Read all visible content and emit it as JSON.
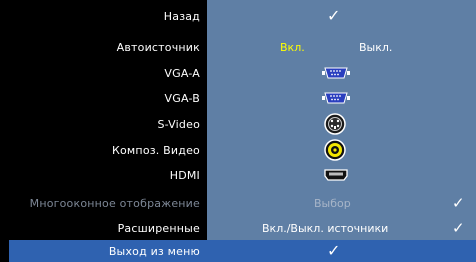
{
  "menu": {
    "rows": [
      {
        "label": "Назад"
      },
      {
        "label": "Автоисточник",
        "on": "Вкл.",
        "off": "Выкл."
      },
      {
        "label": "VGA-A",
        "icon": "vga-connector-icon"
      },
      {
        "label": "VGA-B",
        "icon": "vga-connector-icon"
      },
      {
        "label": "S-Video",
        "icon": "svideo-connector-icon"
      },
      {
        "label": "Композ. Видео",
        "icon": "composite-rca-icon"
      },
      {
        "label": "HDMI",
        "icon": "hdmi-connector-icon"
      },
      {
        "label": "Многооконное отображение",
        "value": "Выбор",
        "disabled": true
      },
      {
        "label": "Расширенные",
        "value": "Вкл./Выкл. источники"
      }
    ],
    "exit_label": "Выход из меню",
    "check_glyph": "✓"
  },
  "colors": {
    "panel": "#5f7fa5",
    "selected": "#2f62b0",
    "on_text": "#ffff00",
    "disabled_text": "#7d8796",
    "background": "#000000"
  }
}
